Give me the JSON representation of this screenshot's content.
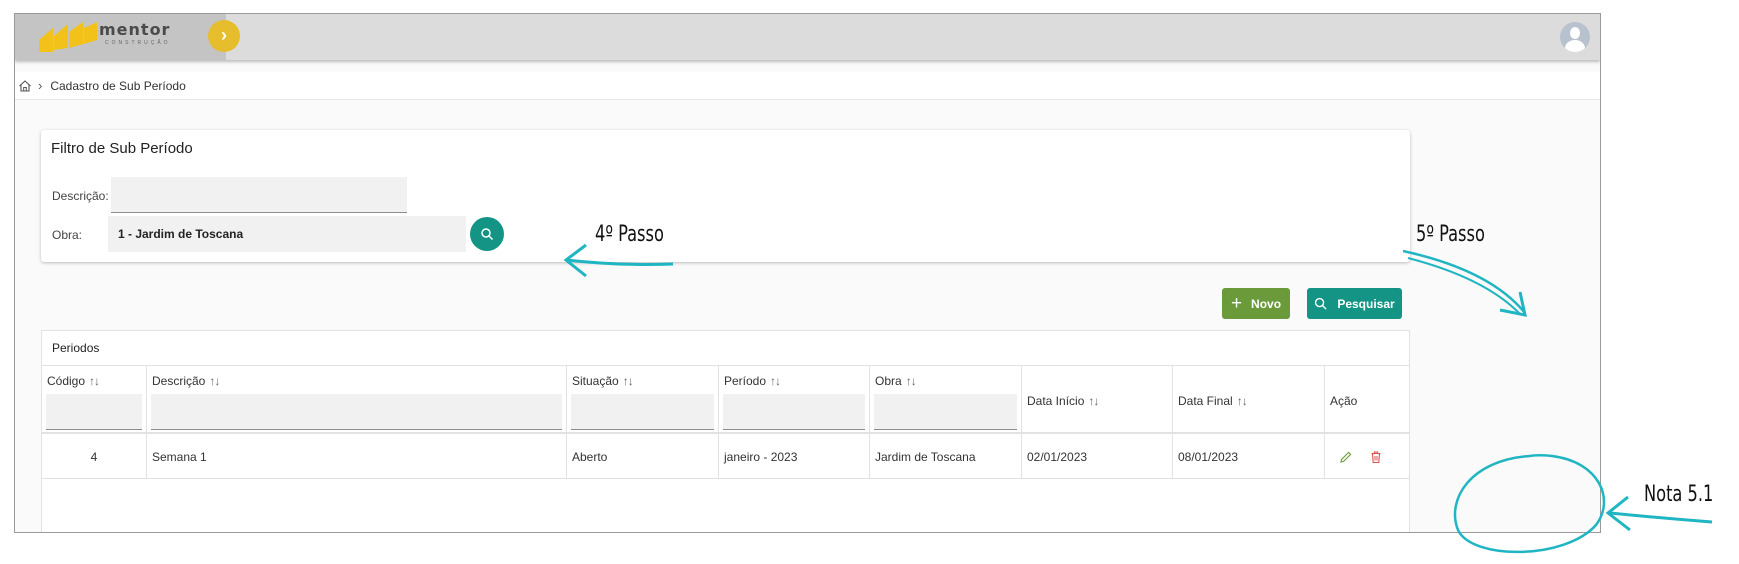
{
  "header": {
    "logo_name": "mentor",
    "logo_sub": "CONSTRUÇÃO",
    "expand_glyph": "›"
  },
  "breadcrumb": {
    "page": "Cadastro de Sub Período"
  },
  "filter": {
    "title": "Filtro de Sub Período",
    "descricao_label": "Descrição:",
    "descricao_value": "",
    "obra_label": "Obra:",
    "obra_value": "1 - Jardim de Toscana"
  },
  "actions": {
    "novo_label": "Novo",
    "pesquisar_label": "Pesquisar"
  },
  "table": {
    "caption": "Periodos",
    "sort_glyph": "↑↓",
    "columns": [
      "Código",
      "Descrição",
      "Situação",
      "Período",
      "Obra",
      "Data Início",
      "Data Final",
      "Ação"
    ],
    "rows": [
      {
        "codigo": "4",
        "descricao": "Semana 1",
        "situacao": "Aberto",
        "periodo": "janeiro - 2023",
        "obra": "Jardim de Toscana",
        "data_inicio": "02/01/2023",
        "data_final": "08/01/2023"
      }
    ]
  },
  "annotations": {
    "step4": "4º Passo",
    "step5": "5º Passo",
    "note": "Nota 5.1"
  },
  "colors": {
    "teal": "#139485",
    "green": "#6b9a3a",
    "logo_yellow": "#e6bd2c",
    "annotation_cyan": "#1fb5c2",
    "delete_red": "#d9534f"
  },
  "icons": {
    "home": "home-icon",
    "search": "search-icon",
    "plus": "plus-icon",
    "edit": "pencil-icon",
    "delete": "trash-icon",
    "avatar": "user-avatar-icon"
  }
}
